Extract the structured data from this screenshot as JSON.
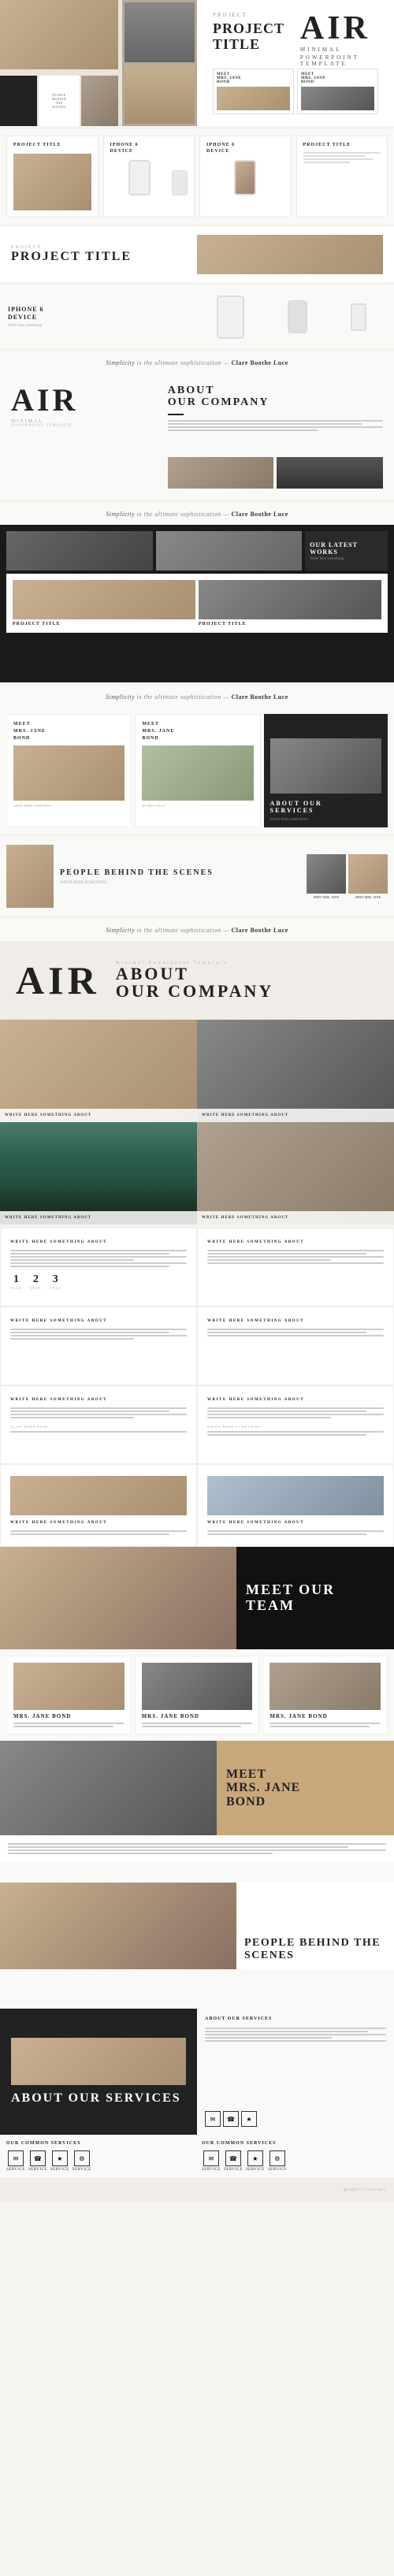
{
  "brand": {
    "name": "AIR",
    "tagline": "MINIMAL",
    "subtitle": "POWERPOINT TEMPLATE"
  },
  "sections": {
    "hero": {
      "label": "PROJECT",
      "title": "PROJECT TITLE",
      "description": "Minimal Powerpoint Template"
    },
    "about": {
      "title": "ABOUT OUR COMPANY",
      "subtitle": "Write here something about"
    },
    "team": {
      "title": "MEET OUR TEAM"
    },
    "person": {
      "meet": "MEET",
      "mrs": "MRS.",
      "jane": "JANE",
      "bond": "BOND"
    },
    "people": {
      "title": "PEOPLE BEHIND THE SCENES"
    },
    "services": {
      "title": "ABOUT OUR SERVICES",
      "common": "OUR COMMON SERVICES"
    }
  },
  "quotes": {
    "simplicity": "Simplicity",
    "rest": "is the ultimate sophistication",
    "dash": "—",
    "author": "Clare Boothe Luce"
  },
  "write_labels": {
    "write_here": "WRITE HERE SOMETHING ABOUT",
    "write_here_short": "WRITE HERE SOMETHING"
  },
  "stats": {
    "items": [
      {
        "num": "1",
        "label": "YEAR"
      },
      {
        "num": "2",
        "label": "YEAR"
      },
      {
        "num": "3",
        "label": "YEAR"
      }
    ]
  },
  "devices": {
    "iphone_title": "IPHONE 6",
    "device_label": "DEVICE",
    "project_title": "PROJECT TITLE"
  },
  "latest_works": "OUR LATEST WORKS",
  "services_list": [
    {
      "icon": "✉",
      "name": "SERVICE"
    },
    {
      "icon": "☎",
      "name": "SERVICE"
    },
    {
      "icon": "★",
      "name": "SERVICE"
    },
    {
      "icon": "⚙",
      "name": "SERVICE"
    }
  ]
}
